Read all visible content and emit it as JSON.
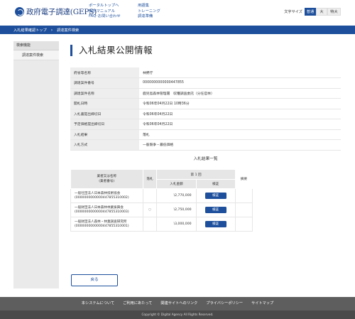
{
  "header": {
    "logo_text": "政府電子調達(GEPS)",
    "links_col1": [
      "ポータルトップへ",
      "操作マニュアル",
      "FAQ･お問い合わせ"
    ],
    "links_col2": [
      "用語集",
      "トレーニング",
      "調達準備"
    ],
    "font_size_label": "文字サイズ",
    "font_sizes": [
      "普通",
      "大",
      "特大"
    ]
  },
  "breadcrumb": [
    "入札結果確認トップ",
    "調達案件検索"
  ],
  "sidebar": {
    "title": "検索機能",
    "items": [
      "調達案件検索"
    ]
  },
  "page_title": "入札結果公開情報",
  "info": [
    {
      "label": "府省等名称",
      "value": "林野庁"
    },
    {
      "label": "調達案件番号",
      "value": "0000000000000447855"
    },
    {
      "label": "調達案件名称",
      "value": "鹿児島森林管理署　収穫調査委託（分任官林）"
    },
    {
      "label": "開札日時",
      "value": "令和06年04月22日 10時36分"
    },
    {
      "label": "入札書提出締切日",
      "value": "令和06年04月22日"
    },
    {
      "label": "予定価格提出締切日",
      "value": "令和06年04月22日"
    },
    {
      "label": "入札結果",
      "value": "落札"
    },
    {
      "label": "入札方式",
      "value": "一般競争・最低価格"
    }
  ],
  "results": {
    "title": "入札結果一覧",
    "headers": {
      "name": "業者又は名称\n(業者番号)",
      "award": "落札",
      "round": "第 1 回",
      "amount": "入札金額",
      "detail": "検証",
      "remarks": "摘要"
    },
    "rows": [
      {
        "name": "一般社団法人日本森林技術協会",
        "number": "(0000000000000447855310002)",
        "award": "",
        "amount": "\\2,770,000",
        "button": "検証"
      },
      {
        "name": "一般財団法人日本森林林業振興会",
        "number": "(0000000000000447855310003)",
        "award": "○",
        "amount": "\\2,750,000",
        "button": "検証"
      },
      {
        "name": "一般財団法人森林・林業調査研究所",
        "number": "(0000000000000447855310001)",
        "award": "",
        "amount": "\\3,000,000",
        "button": "検証"
      }
    ]
  },
  "back_label": "戻る",
  "footer": {
    "links": [
      "本システムについて",
      "ご利用にあたって",
      "関連サイトへのリンク",
      "プライバシーポリシー",
      "サイトマップ"
    ],
    "copyright": "Copyright © Digital Agency All Rights Reserved."
  },
  "colors": {
    "brand": "#1d4f9c",
    "footer": "#5e5e5e",
    "sidebar": "#eaeaea"
  }
}
